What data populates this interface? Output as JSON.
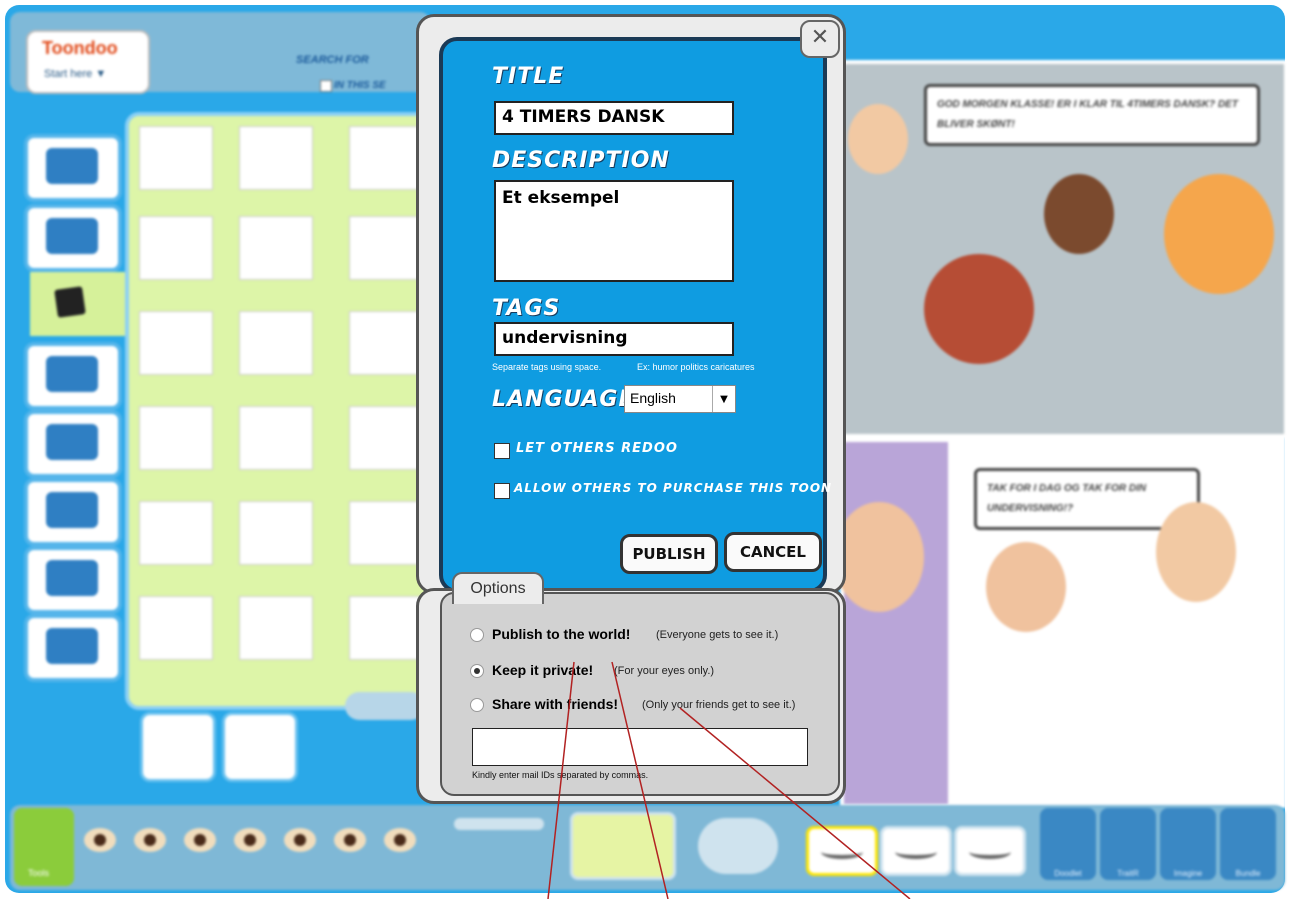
{
  "app": {
    "logo_text": "Toondoo",
    "logo_sub": "Start here ▼",
    "search_label": "SEARCH FOR",
    "in_this_label": "IN THIS SE"
  },
  "dialog": {
    "close_label": "✕",
    "title_label": "TITLE",
    "title_value": "4 TIMERS DANSK",
    "description_label": "DESCRIPTION",
    "description_value": "Et eksempel",
    "tags_label": "TAGS",
    "tags_value": "undervisning",
    "tags_hint_left": "Separate tags using space.",
    "tags_hint_right": "Ex: humor politics caricatures",
    "language_label": "LANGUAGE",
    "language_value": "English",
    "let_others_redoo": "LET OTHERS REDOO",
    "allow_purchase": "ALLOW OTHERS TO PURCHASE THIS TOON",
    "publish_button": "PUBLISH",
    "cancel_button": "CANCEL"
  },
  "options": {
    "tab_label": "Options",
    "items": [
      {
        "label": "Publish to the world!",
        "sub": "(Everyone gets to see it.)",
        "selected": false
      },
      {
        "label": "Keep it private!",
        "sub": "(For your eyes only.)",
        "selected": true
      },
      {
        "label": "Share with friends!",
        "sub": "(Only your friends get to see it.)",
        "selected": false
      }
    ],
    "email_placeholder": "",
    "email_hint": "Kindly enter mail IDs separated by commas."
  },
  "comic": {
    "bubble1": "GOD MORGEN KLASSE! ER I KLAR TIL 4TIMERS DANSK? DET BLIVER SKØNT!",
    "bubble2": "TAK FOR I DAG OG TAK FOR DIN UNDERVISNING!?"
  },
  "bottombar": {
    "tools_label": "Tools",
    "right_buttons": [
      "Doodlet",
      "TraitR",
      "Imagine",
      "Bundle"
    ]
  },
  "colors": {
    "accent_blue": "#0f9ce1",
    "frame_blue": "#2aa8e8",
    "panel_green": "#ddf5a8",
    "annotation_red": "#b22222"
  }
}
